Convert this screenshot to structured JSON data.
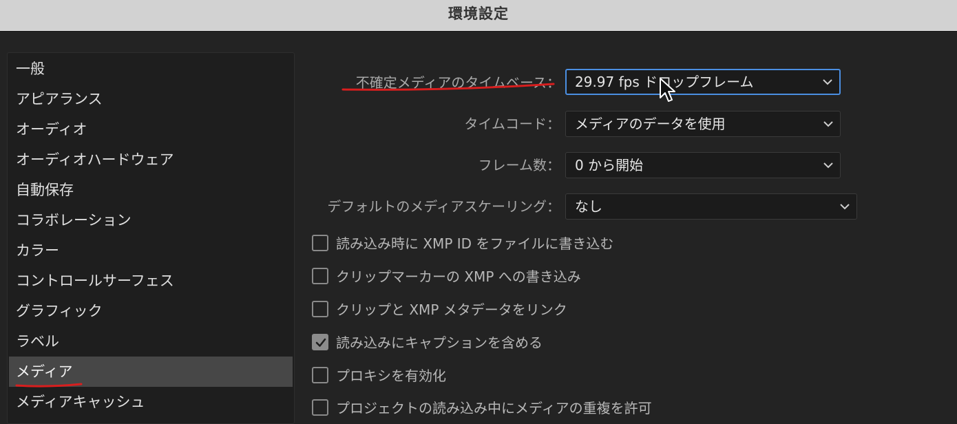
{
  "window": {
    "title": "環境設定"
  },
  "sidebar": {
    "items": [
      {
        "label": "一般"
      },
      {
        "label": "アピアランス"
      },
      {
        "label": "オーディオ"
      },
      {
        "label": "オーディオハードウェア"
      },
      {
        "label": "自動保存"
      },
      {
        "label": "コラボレーション"
      },
      {
        "label": "カラー"
      },
      {
        "label": "コントロールサーフェス"
      },
      {
        "label": "グラフィック"
      },
      {
        "label": "ラベル"
      },
      {
        "label": "メディア"
      },
      {
        "label": "メディアキャッシュ"
      }
    ],
    "selected": "メディア"
  },
  "form": {
    "timebase": {
      "label": "不確定メディアのタイムベース：",
      "value": "29.97 fps ドロップフレーム"
    },
    "timecode": {
      "label": "タイムコード：",
      "value": "メディアのデータを使用"
    },
    "frames": {
      "label": "フレーム数：",
      "value": "0 から開始"
    },
    "scaling": {
      "label": "デフォルトのメディアスケーリング：",
      "value": "なし"
    }
  },
  "checkboxes": [
    {
      "label": "読み込み時に XMP ID をファイルに書き込む",
      "checked": false
    },
    {
      "label": "クリップマーカーの XMP への書き込み",
      "checked": false
    },
    {
      "label": "クリップと XMP メタデータをリンク",
      "checked": false
    },
    {
      "label": "読み込みにキャプションを含める",
      "checked": true
    },
    {
      "label": "プロキシを有効化",
      "checked": false
    },
    {
      "label": "プロジェクトの読み込み中にメディアの重複を許可",
      "checked": false
    }
  ],
  "colors": {
    "annotation_red": "#d81e1e",
    "focus_blue": "#4b8fe2",
    "selected_item_bg": "#474747"
  },
  "icons": {
    "dropdown": "chevron-down-icon",
    "check": "checkmark-icon",
    "cursor": "mouse-pointer-icon"
  }
}
